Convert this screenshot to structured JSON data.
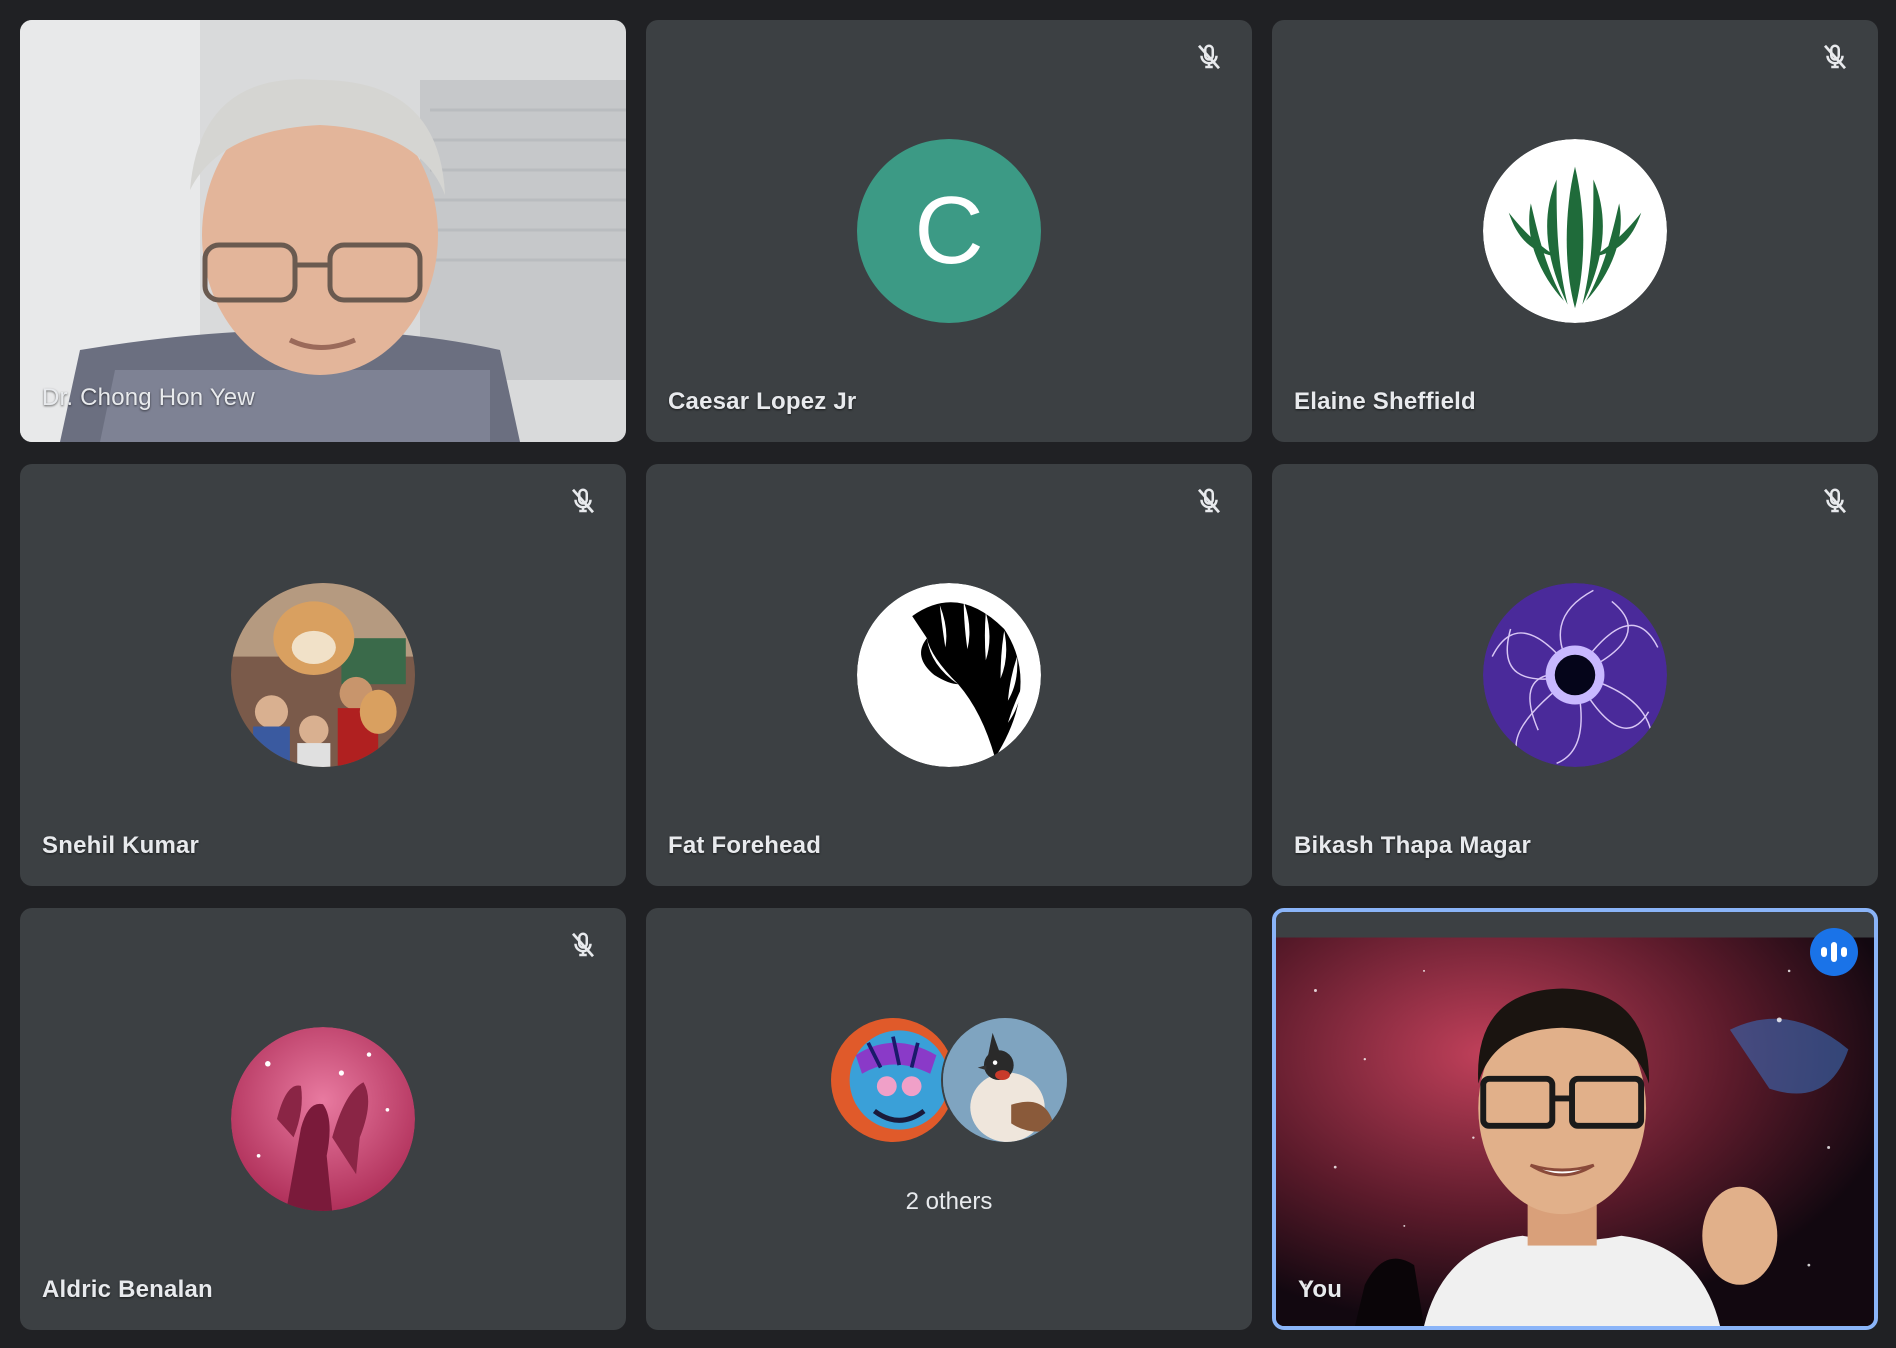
{
  "participants": [
    {
      "name": "Dr. Chong Hon Yew",
      "muted": false,
      "video": true
    },
    {
      "name": "Caesar Lopez Jr",
      "muted": true,
      "initial": "C",
      "avatar_color": "#3c9a85"
    },
    {
      "name": "Elaine Sheffield",
      "muted": true,
      "avatar_icon": "green-plant-logo-icon"
    },
    {
      "name": "Snehil Kumar",
      "muted": true,
      "avatar_icon": "group-photo-with-mascot"
    },
    {
      "name": "Fat Forehead",
      "muted": true,
      "avatar_icon": "black-white-swirl-logo-icon"
    },
    {
      "name": "Bikash Thapa Magar",
      "muted": true,
      "avatar_icon": "purple-eye-sparks-icon"
    },
    {
      "name": "Aldric Benalan",
      "muted": true,
      "avatar_icon": "pink-nebula-pillars"
    },
    {
      "label": "2 others",
      "avatar_icons": [
        "colorful-graffiti-avatar",
        "bird-avatar"
      ]
    },
    {
      "name": "You",
      "muted": false,
      "video": true,
      "speaking": true
    }
  ],
  "colors": {
    "background": "#202124",
    "tile": "#3c4043",
    "active_border": "#8ab4f8",
    "speaking_indicator": "#1a73e8"
  }
}
